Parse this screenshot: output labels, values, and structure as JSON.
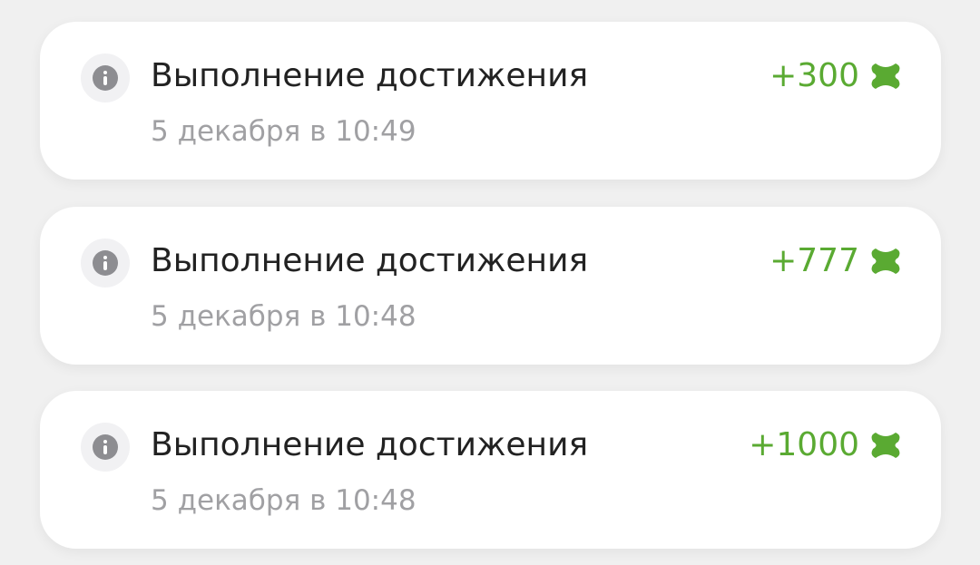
{
  "transactions": [
    {
      "title": "Выполнение достижения",
      "date": "5 декабря в 10:49",
      "amount": "+300",
      "icon": "info-icon",
      "currency_icon": "coin-icon"
    },
    {
      "title": "Выполнение достижения",
      "date": "5 декабря в 10:48",
      "amount": "+777",
      "icon": "info-icon",
      "currency_icon": "coin-icon"
    },
    {
      "title": "Выполнение достижения",
      "date": "5 декабря в 10:48",
      "amount": "+1000",
      "icon": "info-icon",
      "currency_icon": "coin-icon"
    }
  ],
  "colors": {
    "background": "#f0f0f0",
    "card": "#ffffff",
    "title": "#222222",
    "date": "#a0a0a3",
    "amount": "#5aaa32",
    "info_icon": "#8d8d91"
  }
}
